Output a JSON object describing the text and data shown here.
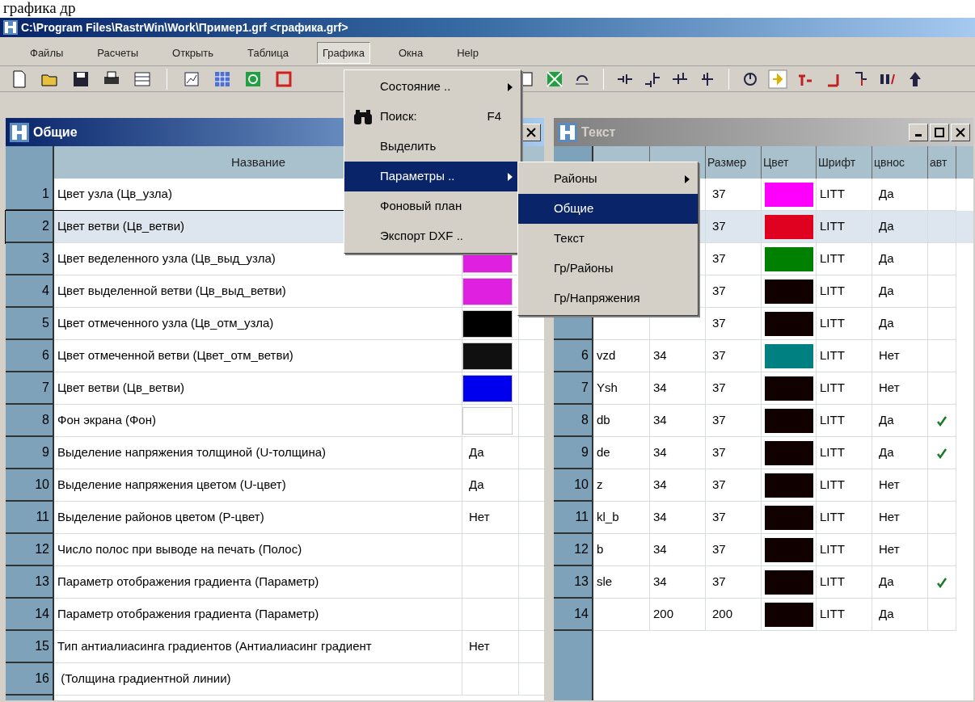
{
  "document_text": "графика др",
  "window": {
    "title": "C:\\Program Files\\RastrWin\\Work\\Пример1.grf <графика.grf>"
  },
  "menu_bar": [
    {
      "label": "Файлы",
      "selected": false
    },
    {
      "label": "Расчеты",
      "selected": false
    },
    {
      "label": "Открыть",
      "selected": false
    },
    {
      "label": "Таблица",
      "selected": false
    },
    {
      "label": "Графика",
      "selected": true
    },
    {
      "label": "Окна",
      "selected": false
    },
    {
      "label": "Help",
      "selected": false
    }
  ],
  "graphics_menu": {
    "items": [
      {
        "label": "Состояние ..",
        "submenu": true,
        "selected": false
      },
      {
        "label": "Поиск:",
        "shortcut": "F4",
        "kind": "icon",
        "submenu": false,
        "selected": false
      },
      {
        "label": "Выделить",
        "submenu": false,
        "selected": false
      },
      {
        "label": "Параметры ..",
        "submenu": true,
        "selected": true
      },
      {
        "label": "Фоновый план",
        "submenu": false,
        "selected": false
      },
      {
        "label": "Экспорт DXF ..",
        "submenu": false,
        "selected": false
      }
    ]
  },
  "parameters_submenu": {
    "items": [
      {
        "label": "Районы",
        "submenu": true,
        "selected": false
      },
      {
        "label": "Общие",
        "submenu": false,
        "selected": true
      },
      {
        "label": "Текст",
        "submenu": false,
        "selected": false
      },
      {
        "label": "Гр/Районы",
        "submenu": false,
        "selected": false
      },
      {
        "label": "Гр/Напряжения",
        "submenu": false,
        "selected": false
      }
    ]
  },
  "general_window": {
    "title": "Общие",
    "active": true,
    "columns": [
      "Название"
    ],
    "rows": [
      {
        "number": "1",
        "name": "Цвет узла (Цв_узла)",
        "kind": "empty",
        "selected": false
      },
      {
        "number": "2",
        "name": "Цвет ветви (Цв_ветви)",
        "kind": "empty",
        "selected": true
      },
      {
        "number": "3",
        "name": "Цвет веделенного узла (Цв_выд_узла)",
        "kind": "color",
        "color": "#e020e0",
        "selected": false
      },
      {
        "number": "4",
        "name": "Цвет выделенной ветви (Цв_выд_ветви)",
        "kind": "color",
        "color": "#e020e0",
        "selected": false
      },
      {
        "number": "5",
        "name": "Цвет отмеченного узла (Цв_отм_узла)",
        "kind": "color",
        "color": "#000000",
        "selected": false
      },
      {
        "number": "6",
        "name": "Цвет отмеченной ветви (Цвет_отм_ветви)",
        "kind": "color",
        "color": "#101010",
        "selected": false
      },
      {
        "number": "7",
        "name": "Цвет ветви (Цв_ветви)",
        "kind": "color",
        "color": "#0000ee",
        "selected": false
      },
      {
        "number": "8",
        "name": "Фон экрана (Фон)",
        "kind": "color",
        "color": "#ffffff",
        "selected": false
      },
      {
        "number": "9",
        "name": "Выделение напряжения толщиной (U-толщина)",
        "kind": "text",
        "value": "Да",
        "selected": false
      },
      {
        "number": "10",
        "name": "Выделение напряжения цветом (U-цвет)",
        "kind": "text",
        "value": "Да",
        "selected": false
      },
      {
        "number": "11",
        "name": "Выделение районов цветом (Р-цвет)",
        "kind": "text",
        "value": "Нет",
        "selected": false
      },
      {
        "number": "12",
        "name": "Число полос при выводе на печать (Полос)",
        "kind": "empty",
        "selected": false
      },
      {
        "number": "13",
        "name": "Параметр отображения градиента (Параметр)",
        "kind": "empty",
        "selected": false
      },
      {
        "number": "14",
        "name": "Параметр отображения градиента (Параметр)",
        "kind": "empty",
        "selected": false
      },
      {
        "number": "15",
        "name": "Тип антиалиасинга градиентов (Антиалиасинг градиент",
        "kind": "text",
        "value": "Нет",
        "selected": false
      },
      {
        "number": "16",
        "name": " (Толщина градиентной линии)",
        "kind": "empty",
        "selected": false
      }
    ]
  },
  "text_window": {
    "title": "Текст",
    "active": false,
    "columns": [
      "Размер",
      "Цвет",
      "Шрифт",
      "цвнос",
      "авт"
    ],
    "rows": [
      {
        "size": "37",
        "color": "#ff00ff",
        "font": "LITT",
        "visible": "Да",
        "auto": false,
        "selected": false
      },
      {
        "size": "37",
        "color": "#e00020",
        "font": "LITT",
        "visible": "Да",
        "auto": false,
        "selected": true
      },
      {
        "size": "37",
        "color": "#008000",
        "font": "LITT",
        "visible": "Да",
        "auto": false,
        "selected": false
      },
      {
        "size": "37",
        "color": "#100000",
        "font": "LITT",
        "visible": "Да",
        "auto": false,
        "selected": false
      },
      {
        "size": "37",
        "color": "#100000",
        "font": "LITT",
        "visible": "Да",
        "auto": false,
        "selected": false
      },
      {
        "number": "6",
        "name": "vzd",
        "k": "34",
        "size": "37",
        "color": "#008080",
        "font": "LITT",
        "visible": "Нет",
        "auto": false,
        "selected": false
      },
      {
        "number": "7",
        "name": "Ysh",
        "k": "34",
        "size": "37",
        "color": "#100000",
        "font": "LITT",
        "visible": "Нет",
        "auto": false,
        "selected": false
      },
      {
        "number": "8",
        "name": "db",
        "k": "34",
        "size": "37",
        "color": "#100000",
        "font": "LITT",
        "visible": "Да",
        "auto": true,
        "selected": false
      },
      {
        "number": "9",
        "name": "de",
        "k": "34",
        "size": "37",
        "color": "#100000",
        "font": "LITT",
        "visible": "Да",
        "auto": true,
        "selected": false
      },
      {
        "number": "10",
        "name": "z",
        "k": "34",
        "size": "37",
        "color": "#100000",
        "font": "LITT",
        "visible": "Нет",
        "auto": false,
        "selected": false
      },
      {
        "number": "11",
        "name": "kl_b",
        "k": "34",
        "size": "37",
        "color": "#100000",
        "font": "LITT",
        "visible": "Нет",
        "auto": false,
        "selected": false
      },
      {
        "number": "12",
        "name": "b",
        "k": "34",
        "size": "37",
        "color": "#100000",
        "font": "LITT",
        "visible": "Нет",
        "auto": false,
        "selected": false
      },
      {
        "number": "13",
        "name": "sle",
        "k": "34",
        "size": "37",
        "color": "#100000",
        "font": "LITT",
        "visible": "Да",
        "auto": true,
        "selected": false
      },
      {
        "number": "14",
        "k": "200",
        "size": "200",
        "color": "#100000",
        "font": "LITT",
        "visible": "Да",
        "auto": false,
        "selected": false
      }
    ]
  }
}
